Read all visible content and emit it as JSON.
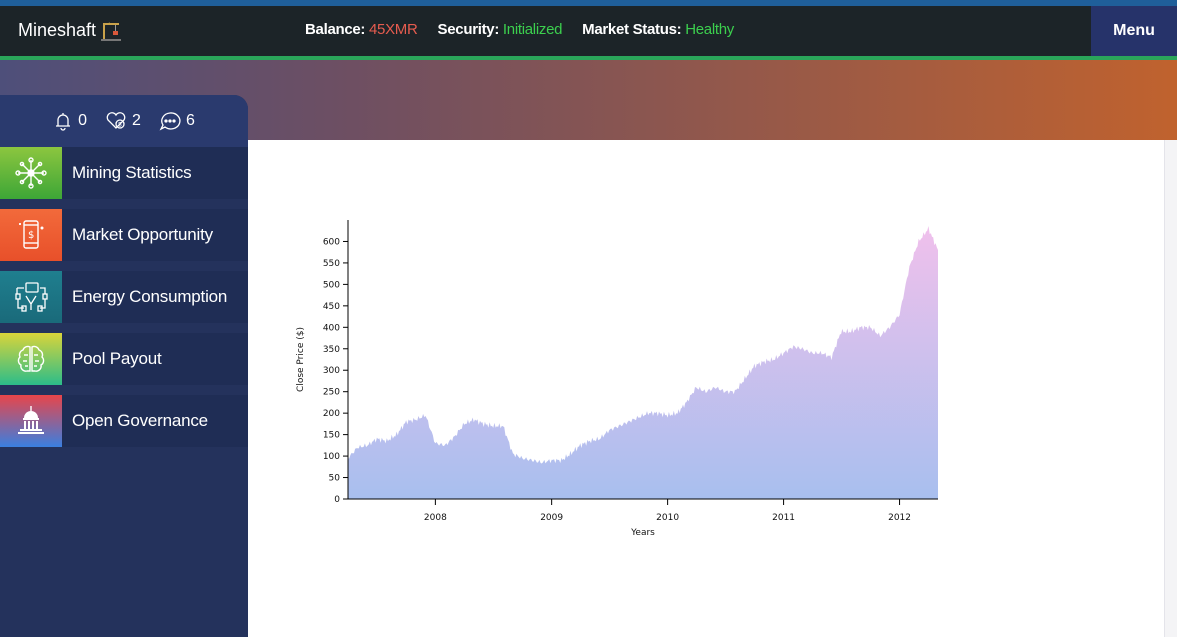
{
  "header": {
    "brand": "Mineshaft",
    "balance_label": "Balance:",
    "balance_value": "45XMR",
    "security_label": "Security:",
    "security_value": "Initialized",
    "market_label": "Market Status:",
    "market_value": "Healthy",
    "menu_label": "Menu"
  },
  "sidebar": {
    "counters": [
      {
        "icon": "bell-icon",
        "value": "0"
      },
      {
        "icon": "heart-coin-icon",
        "value": "2"
      },
      {
        "icon": "chat-icon",
        "value": "6"
      }
    ],
    "items": [
      {
        "label": "Mining Statistics",
        "icon": "network-icon",
        "color_top": "#8cc63f",
        "color_bottom": "#3da637"
      },
      {
        "label": "Market Opportunity",
        "icon": "phone-dollar-icon",
        "color_top": "#f26a3b",
        "color_bottom": "#e8502a"
      },
      {
        "label": "Energy Consumption",
        "icon": "circuit-icon",
        "color_top": "#1f7f8f",
        "color_bottom": "#1a6a7a"
      },
      {
        "label": "Pool Payout",
        "icon": "brain-icon",
        "color_top": "#d9d43a",
        "color_bottom": "#2bbd8a"
      },
      {
        "label": "Open Governance",
        "icon": "capitol-icon",
        "color_top": "#e8454a",
        "color_bottom": "#3a7fe0"
      }
    ]
  },
  "chart_data": {
    "type": "area",
    "xlabel": "Years",
    "ylabel": "Close Price ($)",
    "ylim": [
      0,
      650
    ],
    "xlim": [
      "2007-04-01",
      "2012-05-01"
    ],
    "yticks": [
      0,
      50,
      100,
      150,
      200,
      250,
      300,
      350,
      400,
      450,
      500,
      550,
      600
    ],
    "xticks": [
      "2008",
      "2009",
      "2010",
      "2011",
      "2012"
    ],
    "gradient_top": "#f0c0ec",
    "gradient_bottom": "#a8bfee",
    "x": [
      "2007-04-01",
      "2007-05-01",
      "2007-06-01",
      "2007-07-01",
      "2007-08-01",
      "2007-09-01",
      "2007-10-01",
      "2007-11-01",
      "2007-12-01",
      "2008-01-01",
      "2008-02-01",
      "2008-03-01",
      "2008-04-01",
      "2008-05-01",
      "2008-06-01",
      "2008-07-01",
      "2008-08-01",
      "2008-09-01",
      "2008-10-01",
      "2008-11-01",
      "2008-12-01",
      "2009-01-01",
      "2009-02-01",
      "2009-03-01",
      "2009-04-01",
      "2009-05-01",
      "2009-06-01",
      "2009-07-01",
      "2009-08-01",
      "2009-09-01",
      "2009-10-01",
      "2009-11-01",
      "2009-12-01",
      "2010-01-01",
      "2010-02-01",
      "2010-03-01",
      "2010-04-01",
      "2010-05-01",
      "2010-06-01",
      "2010-07-01",
      "2010-08-01",
      "2010-09-01",
      "2010-10-01",
      "2010-11-01",
      "2010-12-01",
      "2011-01-01",
      "2011-02-01",
      "2011-03-01",
      "2011-04-01",
      "2011-05-01",
      "2011-06-01",
      "2011-07-01",
      "2011-08-01",
      "2011-09-01",
      "2011-10-01",
      "2011-11-01",
      "2011-12-01",
      "2012-01-01",
      "2012-02-01",
      "2012-03-01",
      "2012-04-01",
      "2012-05-01"
    ],
    "values": [
      95,
      120,
      125,
      140,
      135,
      150,
      180,
      185,
      195,
      130,
      125,
      145,
      175,
      185,
      175,
      170,
      170,
      105,
      95,
      90,
      85,
      90,
      90,
      105,
      125,
      135,
      140,
      160,
      170,
      180,
      190,
      200,
      200,
      195,
      200,
      225,
      260,
      250,
      260,
      250,
      250,
      280,
      310,
      320,
      325,
      340,
      355,
      350,
      340,
      340,
      330,
      390,
      390,
      400,
      400,
      380,
      400,
      430,
      540,
      600,
      630,
      580
    ]
  }
}
